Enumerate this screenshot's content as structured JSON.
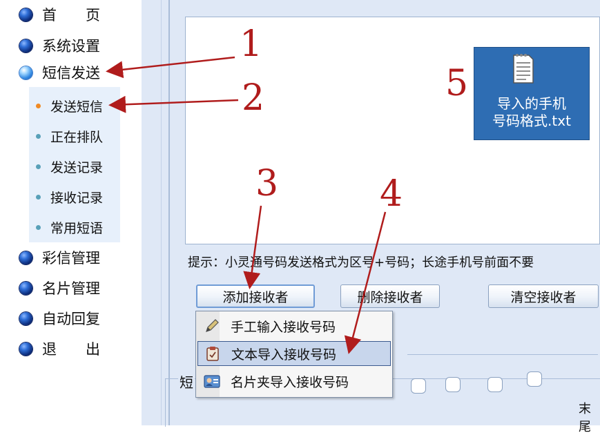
{
  "sidebar": {
    "items": [
      {
        "label": "首　　页",
        "icon": "globe-icon"
      },
      {
        "label": "系统设置",
        "icon": "globe-icon"
      },
      {
        "label": "短信发送",
        "icon": "globe-active-icon"
      },
      {
        "label": "彩信管理",
        "icon": "globe-icon"
      },
      {
        "label": "名片管理",
        "icon": "globe-icon"
      },
      {
        "label": "自动回复",
        "icon": "globe-icon"
      },
      {
        "label": "退　　出",
        "icon": "globe-icon"
      }
    ],
    "submenu": [
      {
        "label": "发送短信",
        "active": true
      },
      {
        "label": "正在排队"
      },
      {
        "label": "发送记录"
      },
      {
        "label": "接收记录"
      },
      {
        "label": "常用短语"
      }
    ]
  },
  "main": {
    "file_tile": {
      "name": "导入的手机\n号码格式.txt",
      "icon": "text-file-icon"
    },
    "hint": "提示：小灵通号码发送格式为区号+号码；长途手机号前面不要",
    "buttons": {
      "add": "添加接收者",
      "delete": "删除接收者",
      "clear": "清空接收者"
    },
    "menu": [
      {
        "label": "手工输入接收号码",
        "icon": "pencil-icon"
      },
      {
        "label": "文本导入接收号码",
        "icon": "clipboard-icon",
        "selected": true
      },
      {
        "label": "名片夹导入接收号码",
        "icon": "contact-card-icon"
      }
    ],
    "group_label": "短",
    "tail_label": "末尾"
  },
  "annotations": {
    "numbers": [
      "1",
      "2",
      "3",
      "4",
      "5"
    ],
    "color": "#b01c1c"
  },
  "colors": {
    "panel_bg": "#dfe8f6",
    "tile_blue": "#2e6db3",
    "menu_selected": "#c8d6ec"
  }
}
